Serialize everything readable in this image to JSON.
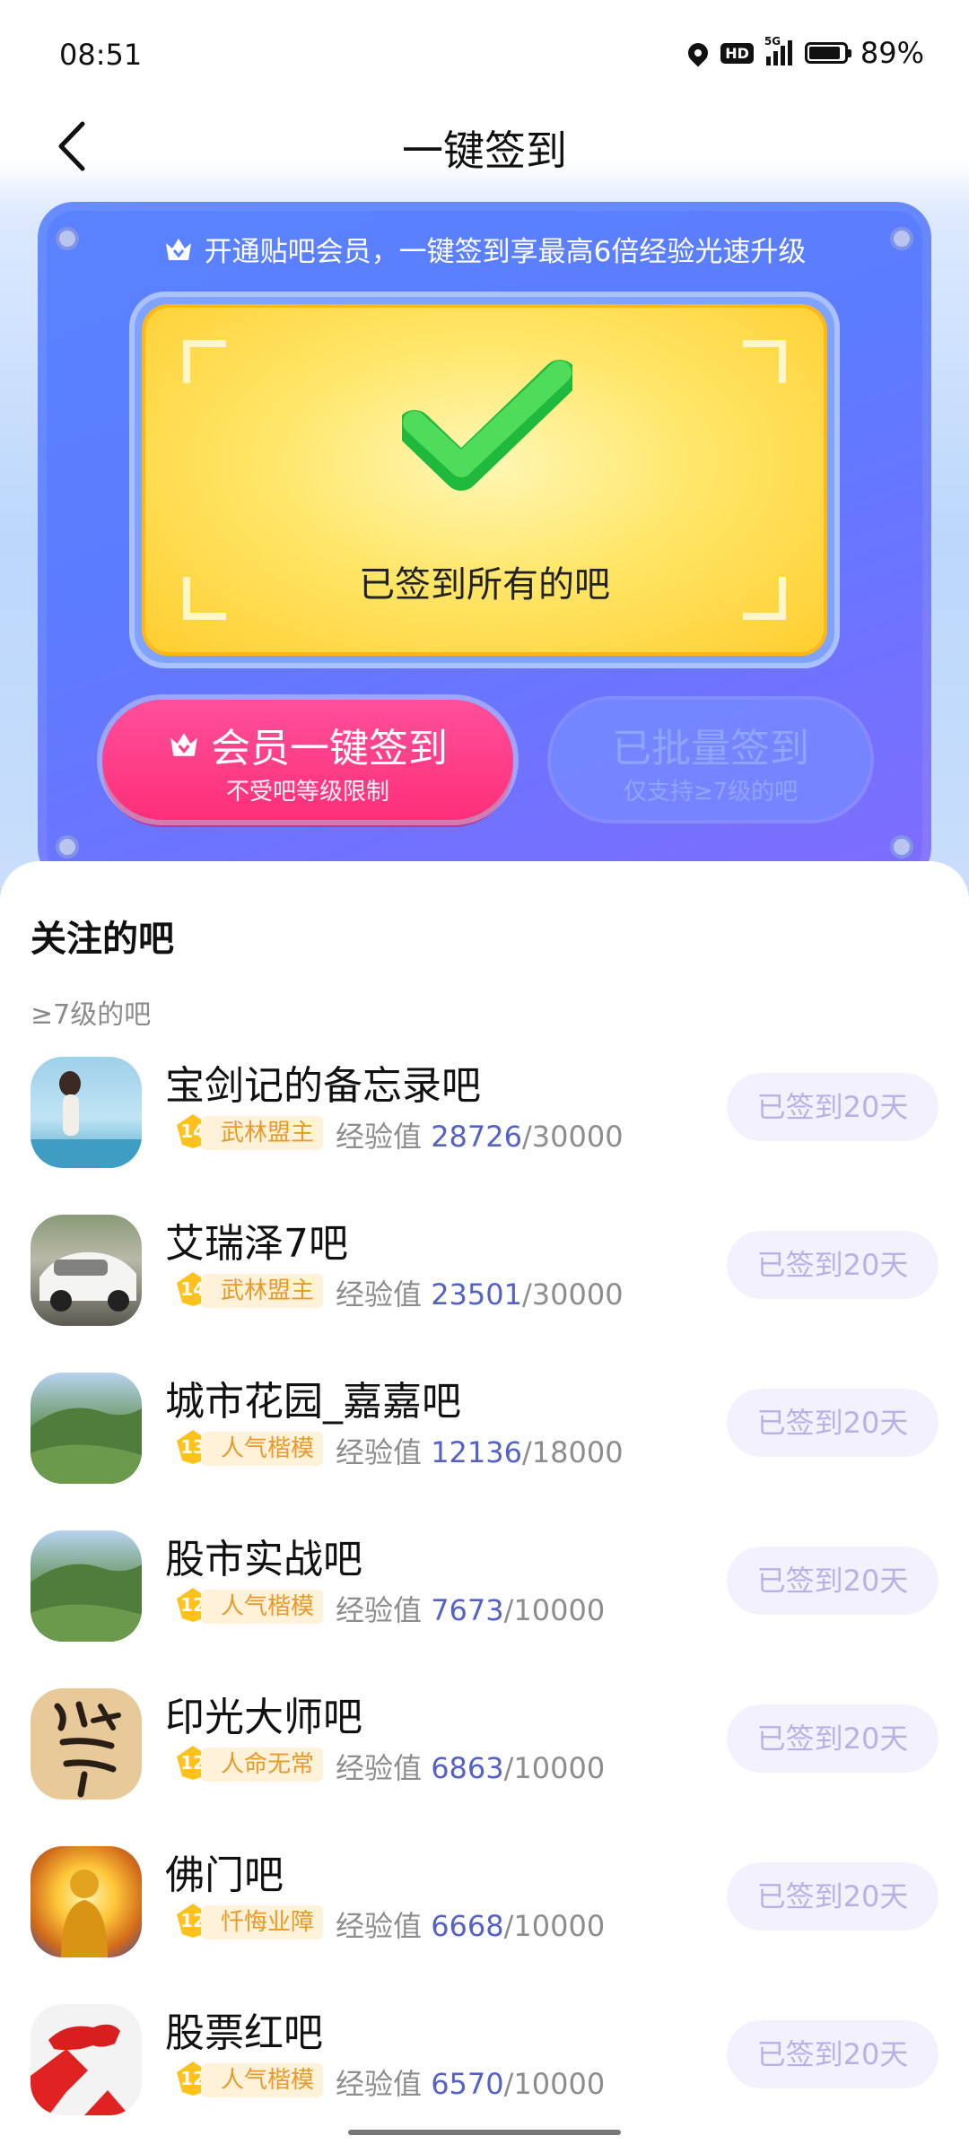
{
  "status_bar": {
    "time": "08:51",
    "battery": "89%",
    "hd": "HD",
    "network": "5G"
  },
  "header": {
    "title": "一键签到"
  },
  "promo": {
    "text": "开通贴吧会员，一键签到享最高6倍经验光速升级"
  },
  "result": {
    "text": "已签到所有的吧"
  },
  "vip_button": {
    "label": "会员一键签到",
    "sub": "不受吧等级限制"
  },
  "batch_button": {
    "label": "已批量签到",
    "sub": "仅支持≥7级的吧"
  },
  "section": {
    "title": "关注的吧",
    "subtitle": "≥7级的吧"
  },
  "colors": {
    "accent": "#5a83ff",
    "vip": "#ff2f78",
    "exp_current": "#5562c5"
  },
  "bars": [
    {
      "name": "宝剑记的备忘录吧",
      "level": "14",
      "title": "武林盟主",
      "exp_label": "经验值",
      "exp_current": "28726",
      "exp_total": "/30000",
      "status": "已签到20天"
    },
    {
      "name": "艾瑞泽7吧",
      "level": "14",
      "title": "武林盟主",
      "exp_label": "经验值",
      "exp_current": "23501",
      "exp_total": "/30000",
      "status": "已签到20天"
    },
    {
      "name": "城市花园_嘉嘉吧",
      "level": "13",
      "title": "人气楷模",
      "exp_label": "经验值",
      "exp_current": "12136",
      "exp_total": "/18000",
      "status": "已签到20天"
    },
    {
      "name": "股市实战吧",
      "level": "12",
      "title": "人气楷模",
      "exp_label": "经验值",
      "exp_current": "7673",
      "exp_total": "/10000",
      "status": "已签到20天"
    },
    {
      "name": "印光大师吧",
      "level": "12",
      "title": "人命无常",
      "exp_label": "经验值",
      "exp_current": "6863",
      "exp_total": "/10000",
      "status": "已签到20天"
    },
    {
      "name": "佛门吧",
      "level": "12",
      "title": "忏悔业障",
      "exp_label": "经验值",
      "exp_current": "6668",
      "exp_total": "/10000",
      "status": "已签到20天"
    },
    {
      "name": "股票红吧",
      "level": "12",
      "title": "人气楷模",
      "exp_label": "经验值",
      "exp_current": "6570",
      "exp_total": "/10000",
      "status": "已签到20天"
    }
  ]
}
